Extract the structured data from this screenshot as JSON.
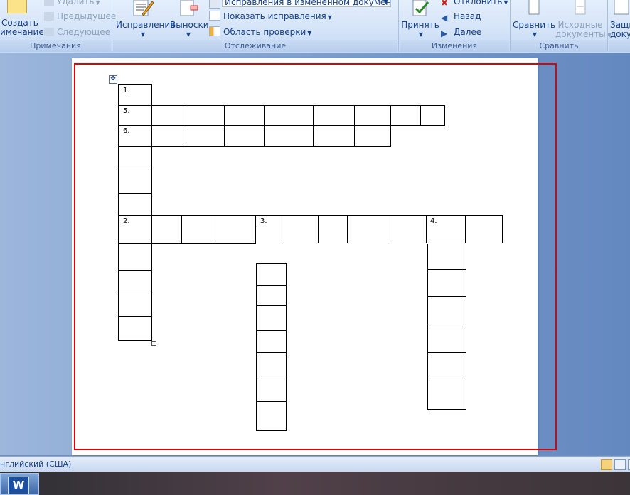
{
  "ribbon": {
    "comments": {
      "group_label": "Примечания",
      "new_comment_line1": "Создать",
      "new_comment_line2": "имечание",
      "delete": "Удалить",
      "previous": "Предыдущее",
      "next": "Следующее"
    },
    "tracking": {
      "group_label": "Отслеживание",
      "track_changes": "Исправления",
      "balloons": "Выноски",
      "display_mode": "Исправления в измененном документе",
      "show_markup": "Показать исправления",
      "reviewing_pane": "Область проверки"
    },
    "changes": {
      "group_label": "Изменения",
      "accept": "Принять",
      "reject": "Отклонить",
      "previous": "Назад",
      "next": "Далее"
    },
    "compare": {
      "group_label": "Сравнить",
      "compare": "Сравнить",
      "source_line1": "Исходные",
      "source_line2": "документы"
    },
    "protect": {
      "label_line1": "Защи",
      "label_line2": "доку"
    }
  },
  "crossword": {
    "numbers": [
      "1.",
      "5.",
      "6.",
      "2.",
      "3.",
      "4."
    ]
  },
  "status": {
    "language": "нглийский (США)"
  },
  "taskbar": {
    "word_icon": "W"
  },
  "colors": {
    "highlight": "#e00000",
    "ribbon_text": "#15428b"
  }
}
